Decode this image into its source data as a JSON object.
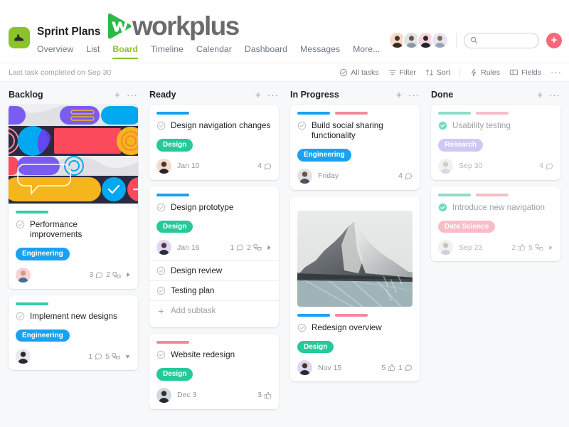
{
  "header": {
    "project_icon": "sneaker-icon",
    "project_title": "Sprint Plans",
    "brand_name": "workplus",
    "nav": [
      {
        "label": "Overview",
        "active": false
      },
      {
        "label": "List",
        "active": false
      },
      {
        "label": "Board",
        "active": true
      },
      {
        "label": "Timeline",
        "active": false
      },
      {
        "label": "Calendar",
        "active": false
      },
      {
        "label": "Dashboard",
        "active": false
      },
      {
        "label": "Messages",
        "active": false
      },
      {
        "label": "More...",
        "active": false
      }
    ],
    "search": {
      "placeholder": "",
      "value": "",
      "icon": "search-icon"
    },
    "add_button_label": "+",
    "members": [
      "member-1",
      "member-2",
      "member-3",
      "member-4"
    ],
    "accent_green": "#8ac32a",
    "accent_pink": "#f9686e"
  },
  "subbar": {
    "status_text": "Last task completed on Sep 30",
    "tools": [
      {
        "label": "All tasks",
        "icon": "check-circle-icon"
      },
      {
        "label": "Filter",
        "icon": "filter-icon"
      },
      {
        "label": "Sort",
        "icon": "sort-icon"
      },
      {
        "label": "Rules",
        "icon": "lightning-icon"
      },
      {
        "label": "Fields",
        "icon": "fields-icon"
      },
      {
        "label": "···",
        "icon": "more-icon"
      }
    ]
  },
  "board": {
    "columns": [
      {
        "title": "Backlog",
        "add_label": "+",
        "menu_label": "···",
        "cards": [
          {
            "cover": "abstract-collage-cover",
            "bars": [
              "#2ecfa8"
            ],
            "title": "Performance improvements",
            "tag": {
              "label": "Engineering",
              "color": "#1aa1f1"
            },
            "avatar": "assignee-avatar",
            "date": "",
            "meta": [
              {
                "icon": "comment-icon",
                "count": "3"
              },
              {
                "icon": "subtask-icon",
                "count": "2"
              },
              {
                "icon": "caret-right-icon",
                "count": ""
              }
            ],
            "done": false
          },
          {
            "cover": "",
            "bars": [
              "#2ecfa8"
            ],
            "title": "Implement new designs",
            "tag": {
              "label": "Engineering",
              "color": "#1aa1f1"
            },
            "avatar": "assignee-avatar",
            "date": "",
            "meta": [
              {
                "icon": "comment-icon",
                "count": "1"
              },
              {
                "icon": "subtask-icon",
                "count": "5"
              },
              {
                "icon": "caret-down-icon",
                "count": ""
              }
            ],
            "done": false
          }
        ]
      },
      {
        "title": "Ready",
        "add_label": "+",
        "menu_label": "···",
        "cards": [
          {
            "cover": "",
            "bars": [
              "#1aa1f1"
            ],
            "title": "Design navigation changes",
            "tag": {
              "label": "Design",
              "color": "#25c99a"
            },
            "avatar": "assignee-avatar",
            "date": "Jan 10",
            "meta": [
              {
                "icon": "comment-icon",
                "count": "4"
              }
            ],
            "done": false
          },
          {
            "cover": "",
            "bars": [
              "#1aa1f1"
            ],
            "title": "Design prototype",
            "tag": {
              "label": "Design",
              "color": "#25c99a"
            },
            "avatar": "assignee-avatar",
            "date": "Jan 16",
            "meta": [
              {
                "icon": "comment-icon",
                "count": "1"
              },
              {
                "icon": "subtask-icon",
                "count": "2"
              },
              {
                "icon": "caret-right-icon",
                "count": ""
              }
            ],
            "subtasks": [
              {
                "label": "Design review",
                "icon": "check-circle-icon"
              },
              {
                "label": "Testing plan",
                "icon": "check-circle-icon"
              },
              {
                "label": "Add subtask",
                "icon": "plus-icon"
              }
            ],
            "done": false
          },
          {
            "cover": "",
            "bars": [
              "#f4899b"
            ],
            "title": "Website redesign",
            "tag": {
              "label": "Design",
              "color": "#25c99a"
            },
            "avatar": "assignee-avatar",
            "date": "Dec 3",
            "meta": [
              {
                "icon": "like-icon",
                "count": "3"
              }
            ],
            "done": false
          }
        ]
      },
      {
        "title": "In Progress",
        "add_label": "+",
        "menu_label": "···",
        "cards": [
          {
            "cover": "",
            "bars": [
              "#1aa1f1",
              "#f4899b"
            ],
            "title": "Build social sharing functionality",
            "tag": {
              "label": "Engineering",
              "color": "#1aa1f1"
            },
            "avatar": "assignee-avatar",
            "date": "Friday",
            "meta": [
              {
                "icon": "comment-icon",
                "count": "4"
              }
            ],
            "done": false
          },
          {
            "cover": "mountain-photo-cover",
            "bars": [
              "#1aa1f1",
              "#f4899b"
            ],
            "title": "Redesign overview",
            "tag": {
              "label": "Design",
              "color": "#25c99a"
            },
            "avatar": "assignee-avatar",
            "date": "Nov 15",
            "meta": [
              {
                "icon": "like-icon",
                "count": "5"
              },
              {
                "icon": "comment-icon",
                "count": "1"
              }
            ],
            "done": false
          }
        ]
      },
      {
        "title": "Done",
        "add_label": "+",
        "menu_label": "···",
        "cards": [
          {
            "cover": "",
            "bars": [
              "#8fdcc8",
              "#f7bcc6"
            ],
            "title": "Usability testing",
            "tag": {
              "label": "Research",
              "color": "#a99cf2"
            },
            "avatar": "assignee-avatar",
            "date": "Sep 30",
            "meta": [
              {
                "icon": "comment-icon",
                "count": "4"
              }
            ],
            "done": true
          },
          {
            "cover": "",
            "bars": [
              "#8fdcc8",
              "#f7bcc6"
            ],
            "title": "Introduce new navigation",
            "tag": {
              "label": "Data Science",
              "color": "#f4899b"
            },
            "avatar": "assignee-avatar",
            "date": "Sep 23",
            "meta": [
              {
                "icon": "like-icon",
                "count": "2"
              },
              {
                "icon": "subtask-icon",
                "count": "5"
              },
              {
                "icon": "caret-right-icon",
                "count": ""
              }
            ],
            "done": true
          }
        ]
      }
    ]
  }
}
